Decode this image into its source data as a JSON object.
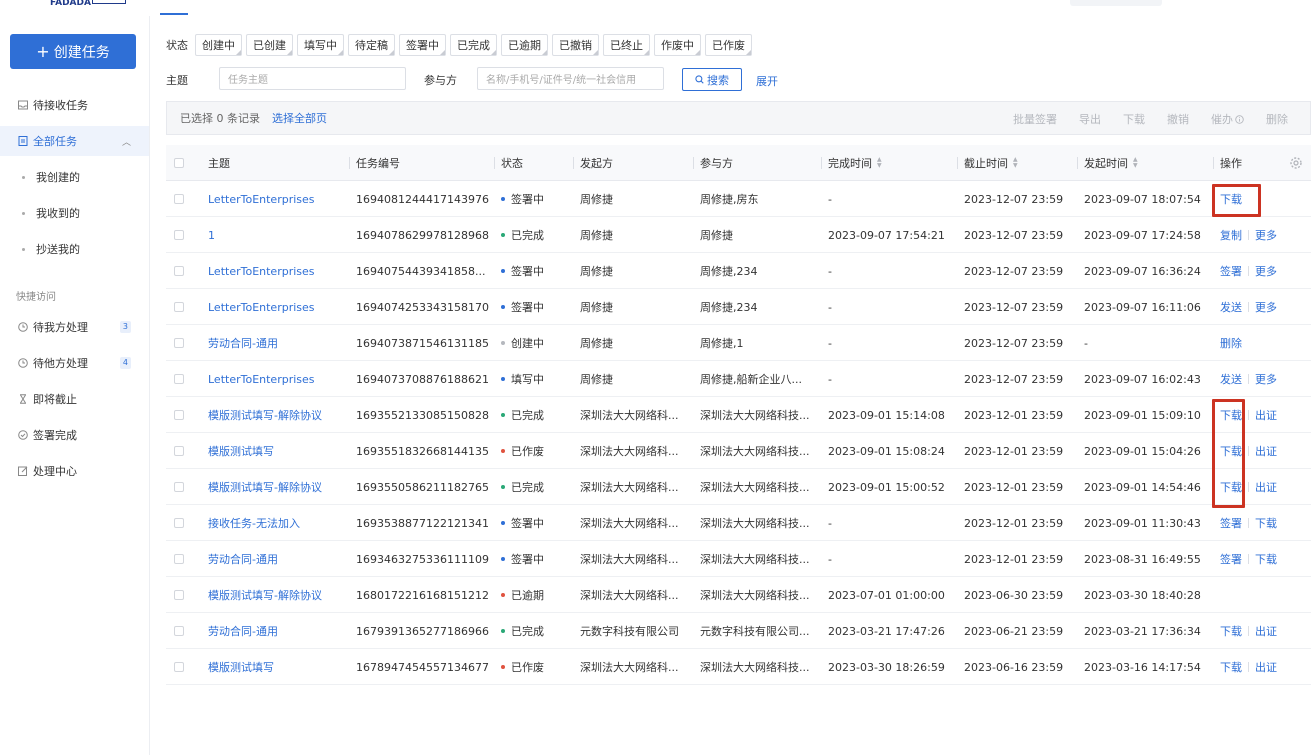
{
  "colors": {
    "accent": "#2f6fd6",
    "highlight": "#cc3322"
  },
  "header": {
    "logo_text": "FADADA"
  },
  "sidebar": {
    "create_button": "创建任务",
    "items": [
      {
        "label": "待接收任务",
        "icon": "inbox-icon"
      },
      {
        "label": "全部任务",
        "icon": "document-icon",
        "active": true
      },
      {
        "label": "我创建的"
      },
      {
        "label": "我收到的"
      },
      {
        "label": "抄送我的"
      }
    ],
    "quick_access_label": "快捷访问",
    "quick_items": [
      {
        "label": "待我方处理",
        "badge": "3",
        "icon": "clock-icon"
      },
      {
        "label": "待他方处理",
        "badge": "4",
        "icon": "clock-icon"
      },
      {
        "label": "即将截止",
        "icon": "hourglass-icon"
      },
      {
        "label": "签署完成",
        "icon": "check-circle-icon"
      },
      {
        "label": "处理中心",
        "icon": "edit-icon"
      }
    ]
  },
  "filters": {
    "status_label": "状态",
    "statuses": [
      "创建中",
      "已创建",
      "填写中",
      "待定稿",
      "签署中",
      "已完成",
      "已逾期",
      "已撤销",
      "已终止",
      "作废中",
      "已作废"
    ],
    "subject_label": "主题",
    "subject_placeholder": "任务主题",
    "participant_label": "参与方",
    "participant_placeholder": "名称/手机号/证件号/统一社会信用",
    "search_button": "搜索",
    "expand_link": "展开"
  },
  "selection_bar": {
    "count_text": "已选择 0 条记录",
    "select_all": "选择全部页",
    "actions": [
      "批量签署",
      "导出",
      "下载",
      "撤销",
      "催办",
      "删除"
    ]
  },
  "table": {
    "columns": [
      "主题",
      "任务编号",
      "状态",
      "发起方",
      "参与方",
      "完成时间",
      "截止时间",
      "发起时间",
      "操作"
    ],
    "rows": [
      {
        "subject": "LetterToEnterprises",
        "id": "1694081244417143976",
        "status": "签署中",
        "status_color": "#2f6fd6",
        "initiator": "周修捷",
        "participants": "周修捷,房东",
        "completed": "-",
        "deadline": "2023-12-07 23:59",
        "started": "2023-09-07 18:07:54",
        "ops": [
          "下载"
        ]
      },
      {
        "subject": "1",
        "id": "1694078629978128968",
        "status": "已完成",
        "status_color": "#2aa876",
        "initiator": "周修捷",
        "participants": "周修捷",
        "completed": "2023-09-07 17:54:21",
        "deadline": "2023-12-07 23:59",
        "started": "2023-09-07 17:24:58",
        "ops": [
          "复制",
          "更多"
        ]
      },
      {
        "subject": "LetterToEnterprises",
        "id": "1694075443934185​8...",
        "status": "签署中",
        "status_color": "#2f6fd6",
        "initiator": "周修捷",
        "participants": "周修捷,234",
        "completed": "-",
        "deadline": "2023-12-07 23:59",
        "started": "2023-09-07 16:36:24",
        "ops": [
          "签署",
          "更多"
        ]
      },
      {
        "subject": "LetterToEnterprises",
        "id": "1694074253343158170",
        "status": "签署中",
        "status_color": "#2f6fd6",
        "initiator": "周修捷",
        "participants": "周修捷,234",
        "completed": "-",
        "deadline": "2023-12-07 23:59",
        "started": "2023-09-07 16:11:06",
        "ops": [
          "发送",
          "更多"
        ]
      },
      {
        "subject": "劳动合同-通用",
        "id": "1694073871546131185",
        "status": "创建中",
        "status_color": "#b5b8be",
        "initiator": "周修捷",
        "participants": "周修捷,1",
        "completed": "-",
        "deadline": "2023-12-07 23:59",
        "started": "-",
        "ops": [
          "删除"
        ]
      },
      {
        "subject": "LetterToEnterprises",
        "id": "1694073708876188621",
        "status": "填写中",
        "status_color": "#2f6fd6",
        "initiator": "周修捷",
        "participants": "周修捷,船新企业八...",
        "completed": "-",
        "deadline": "2023-12-07 23:59",
        "started": "2023-09-07 16:02:43",
        "ops": [
          "发送",
          "更多"
        ]
      },
      {
        "subject": "模版测试填写-解除协议",
        "id": "1693552133085150828",
        "status": "已完成",
        "status_color": "#2aa876",
        "initiator": "深圳法大大网络科...",
        "participants": "深圳法大大网络科技...",
        "completed": "2023-09-01 15:14:08",
        "deadline": "2023-12-01 23:59",
        "started": "2023-09-01 15:09:10",
        "ops": [
          "下载",
          "出证"
        ]
      },
      {
        "subject": "模版测试填写",
        "id": "1693551832668144135",
        "status": "已作废",
        "status_color": "#e0533f",
        "initiator": "深圳法大大网络科...",
        "participants": "深圳法大大网络科技...",
        "completed": "2023-09-01 15:08:24",
        "deadline": "2023-12-01 23:59",
        "started": "2023-09-01 15:04:26",
        "ops": [
          "下载",
          "出证"
        ]
      },
      {
        "subject": "模版测试填写-解除协议",
        "id": "1693550586211182765",
        "status": "已完成",
        "status_color": "#2aa876",
        "initiator": "深圳法大大网络科...",
        "participants": "深圳法大大网络科技...",
        "completed": "2023-09-01 15:00:52",
        "deadline": "2023-12-01 23:59",
        "started": "2023-09-01 14:54:46",
        "ops": [
          "下载",
          "出证"
        ]
      },
      {
        "subject": "接收任务-无法加入",
        "id": "1693538877122121341",
        "status": "签署中",
        "status_color": "#2f6fd6",
        "initiator": "深圳法大大网络科...",
        "participants": "深圳法大大网络科技...",
        "completed": "-",
        "deadline": "2023-12-01 23:59",
        "started": "2023-09-01 11:30:43",
        "ops": [
          "签署",
          "下载"
        ]
      },
      {
        "subject": "劳动合同-通用",
        "id": "1693463275336111109",
        "status": "签署中",
        "status_color": "#2f6fd6",
        "initiator": "深圳法大大网络科...",
        "participants": "深圳法大大网络科技...",
        "completed": "-",
        "deadline": "2023-12-01 23:59",
        "started": "2023-08-31 16:49:55",
        "ops": [
          "签署",
          "下载"
        ]
      },
      {
        "subject": "模版测试填写-解除协议",
        "id": "1680172216168151212",
        "status": "已逾期",
        "status_color": "#e0533f",
        "initiator": "深圳法大大网络科...",
        "participants": "深圳法大大网络科技...",
        "completed": "2023-07-01 01:00:00",
        "deadline": "2023-06-30 23:59",
        "started": "2023-03-30 18:40:28",
        "ops": []
      },
      {
        "subject": "劳动合同-通用",
        "id": "1679391365277186966",
        "status": "已完成",
        "status_color": "#2aa876",
        "initiator": "元数字科技有限公司",
        "participants": "元数字科技有限公司...",
        "completed": "2023-03-21 17:47:26",
        "deadline": "2023-06-21 23:59",
        "started": "2023-03-21 17:36:34",
        "ops": [
          "下载",
          "出证"
        ]
      },
      {
        "subject": "模版测试填写",
        "id": "1678947454557134677",
        "status": "已作废",
        "status_color": "#e0533f",
        "initiator": "深圳法大大网络科...",
        "participants": "深圳法大大网络科技...",
        "completed": "2023-03-30 18:26:59",
        "deadline": "2023-06-16 23:59",
        "started": "2023-03-16 14:17:54",
        "ops": [
          "下载",
          "出证"
        ]
      }
    ]
  }
}
